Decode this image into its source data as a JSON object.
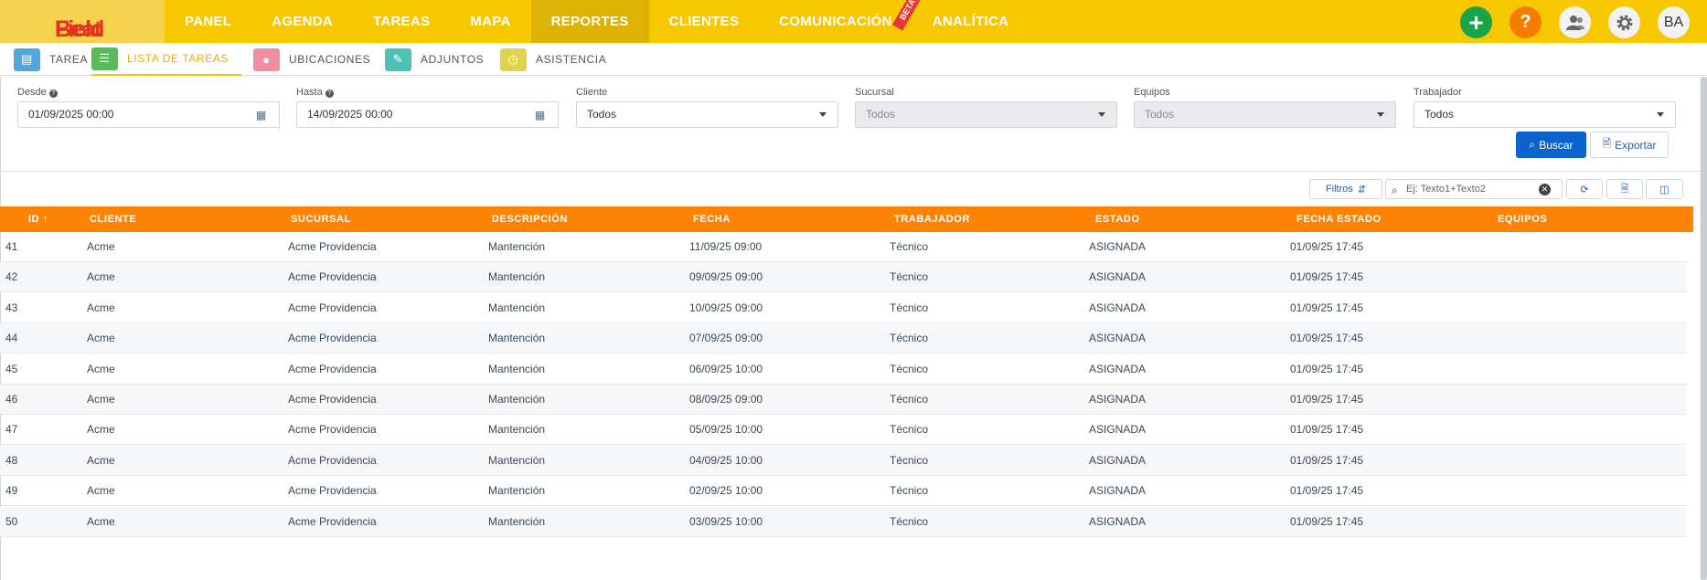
{
  "brand": {
    "part1": "Field",
    "part2": "Beat"
  },
  "nav": {
    "items": [
      {
        "label": "PANEL"
      },
      {
        "label": "AGENDA"
      },
      {
        "label": "TAREAS"
      },
      {
        "label": "MAPA"
      },
      {
        "label": "REPORTES"
      },
      {
        "label": "CLIENTES"
      },
      {
        "label": "COMUNICACIÓN"
      },
      {
        "label": "ANALÍTICA"
      }
    ],
    "active": "REPORTES",
    "beta_badge": "BETA"
  },
  "top_actions": {
    "plus": "+",
    "help": "?",
    "avatar": "BA"
  },
  "subtabs": [
    {
      "label": "TAREA",
      "color": "#4fa8dc"
    },
    {
      "label": "LISTA DE TAREAS",
      "color": "#5cb85c"
    },
    {
      "label": "UBICACIONES",
      "color": "#f08ea0"
    },
    {
      "label": "ADJUNTOS",
      "color": "#4cc1b5"
    },
    {
      "label": "ASISTENCIA",
      "color": "#e0d24a"
    }
  ],
  "filters": {
    "desde_label": "Desde",
    "desde_value": "01/09/2025 00:00",
    "hasta_label": "Hasta",
    "hasta_value": "14/09/2025 00:00",
    "cliente_label": "Cliente",
    "cliente_value": "Todos",
    "sucursal_label": "Sucursal",
    "sucursal_value": "Todos",
    "equipos_label": "Equipos",
    "equipos_value": "Todos",
    "trabajador_label": "Trabajador",
    "trabajador_value": "Todos",
    "buscar_label": "Buscar",
    "exportar_label": "Exportar"
  },
  "toolbar": {
    "filtros_label": "Filtros",
    "search_placeholder": "Ej: Texto1+Texto2"
  },
  "table": {
    "columns": [
      "ID",
      "CLIENTE",
      "SUCURSAL",
      "DESCRIPCIÓN",
      "FECHA",
      "TRABAJADOR",
      "ESTADO",
      "FECHA ESTADO",
      "EQUIPOS"
    ],
    "sort_indicator": "↑",
    "rows": [
      [
        "41",
        "Acme",
        "Acme Providencia",
        "Mantención",
        "11/09/25 09:00",
        "Técnico",
        "ASIGNADA",
        "01/09/25 17:45",
        ""
      ],
      [
        "42",
        "Acme",
        "Acme Providencia",
        "Mantención",
        "09/09/25 09:00",
        "Técnico",
        "ASIGNADA",
        "01/09/25 17:45",
        ""
      ],
      [
        "43",
        "Acme",
        "Acme Providencia",
        "Mantención",
        "10/09/25 09:00",
        "Técnico",
        "ASIGNADA",
        "01/09/25 17:45",
        ""
      ],
      [
        "44",
        "Acme",
        "Acme Providencia",
        "Mantención",
        "07/09/25 09:00",
        "Técnico",
        "ASIGNADA",
        "01/09/25 17:45",
        ""
      ],
      [
        "45",
        "Acme",
        "Acme Providencia",
        "Mantención",
        "06/09/25 10:00",
        "Técnico",
        "ASIGNADA",
        "01/09/25 17:45",
        ""
      ],
      [
        "46",
        "Acme",
        "Acme Providencia",
        "Mantención",
        "08/09/25 09:00",
        "Técnico",
        "ASIGNADA",
        "01/09/25 17:45",
        ""
      ],
      [
        "47",
        "Acme",
        "Acme Providencia",
        "Mantención",
        "05/09/25 10:00",
        "Técnico",
        "ASIGNADA",
        "01/09/25 17:45",
        ""
      ],
      [
        "48",
        "Acme",
        "Acme Providencia",
        "Mantención",
        "04/09/25 10:00",
        "Técnico",
        "ASIGNADA",
        "01/09/25 17:45",
        ""
      ],
      [
        "49",
        "Acme",
        "Acme Providencia",
        "Mantención",
        "02/09/25 10:00",
        "Técnico",
        "ASIGNADA",
        "01/09/25 17:45",
        ""
      ],
      [
        "50",
        "Acme",
        "Acme Providencia",
        "Mantención",
        "03/09/25 10:00",
        "Técnico",
        "ASIGNADA",
        "01/09/25 17:45",
        ""
      ]
    ]
  },
  "colors": {
    "topbar": "#f7c700",
    "table_header": "#ff8200",
    "primary_button": "#0b63ce"
  }
}
